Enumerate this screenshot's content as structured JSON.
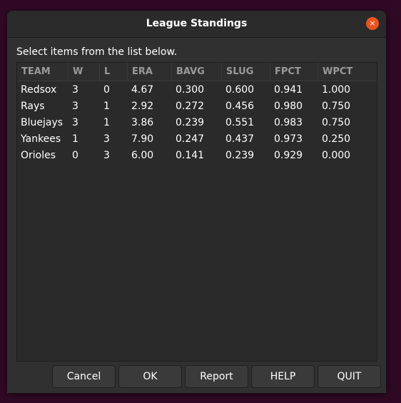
{
  "window": {
    "title": "League Standings",
    "close_glyph": "×"
  },
  "instruction": "Select items from the list below.",
  "table": {
    "columns": [
      "TEAM",
      "W",
      "L",
      "ERA",
      "BAVG",
      "SLUG",
      "FPCT",
      "WPCT"
    ],
    "rows": [
      [
        "Redsox",
        "3",
        "0",
        "4.67",
        "0.300",
        "0.600",
        "0.941",
        "1.000"
      ],
      [
        "Rays",
        "3",
        "1",
        "2.92",
        "0.272",
        "0.456",
        "0.980",
        "0.750"
      ],
      [
        "Bluejays",
        "3",
        "1",
        "3.86",
        "0.239",
        "0.551",
        "0.983",
        "0.750"
      ],
      [
        "Yankees",
        "1",
        "3",
        "7.90",
        "0.247",
        "0.437",
        "0.973",
        "0.250"
      ],
      [
        "Orioles",
        "0",
        "3",
        "6.00",
        "0.141",
        "0.239",
        "0.929",
        "0.000"
      ]
    ]
  },
  "buttons": {
    "cancel": "Cancel",
    "ok": "OK",
    "report": "Report",
    "help": "HELP",
    "quit": "QUIT"
  },
  "colors": {
    "desktop": "#300a24",
    "close_button": "#e95420"
  },
  "icons": {
    "close": "close-icon"
  }
}
